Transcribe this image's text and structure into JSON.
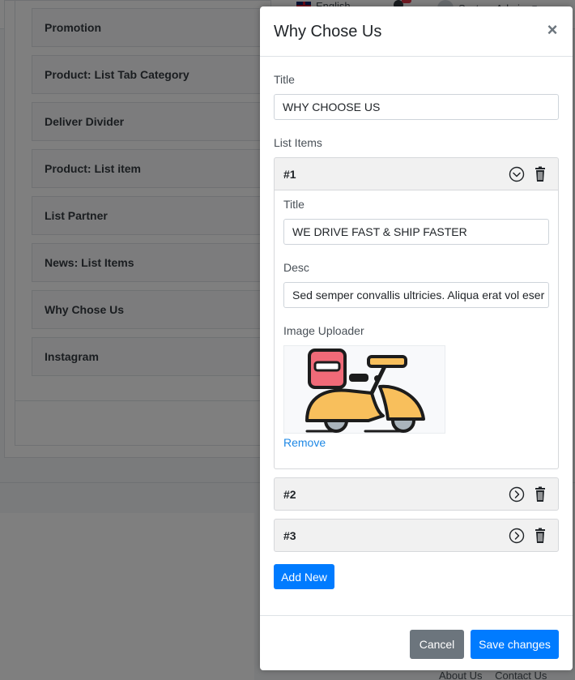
{
  "topbar": {
    "language": "English",
    "user": "System Admin"
  },
  "background": {
    "items": [
      "Promotion",
      "Product: List Tab Category",
      "Deliver Divider",
      "Product: List item",
      "List Partner",
      "News: List Items",
      "Why Chose Us",
      "Instagram"
    ],
    "footer_links": [
      "About Us",
      "Contact Us"
    ]
  },
  "modal": {
    "title": "Why Chose Us",
    "close_symbol": "×",
    "title_label": "Title",
    "title_value": "WHY CHOOSE US",
    "list_label": "List Items",
    "items": [
      {
        "number": "#1",
        "expanded": true,
        "title_label": "Title",
        "title_value": "WE DRIVE FAST & SHIP FASTER",
        "desc_label": "Desc",
        "desc_value": "Sed semper convallis ultricies. Aliqua erat vol eser",
        "image_label": "Image Uploader",
        "image_icon": "scooter-icon",
        "remove_label": "Remove"
      },
      {
        "number": "#2",
        "expanded": false
      },
      {
        "number": "#3",
        "expanded": false
      }
    ],
    "add_new_label": "Add New",
    "cancel_label": "Cancel",
    "save_label": "Save changes"
  },
  "colors": {
    "primary": "#007bff",
    "secondary": "#6c757d",
    "link": "#1e88e5",
    "backdrop": "rgba(0,0,0,0.5)"
  }
}
